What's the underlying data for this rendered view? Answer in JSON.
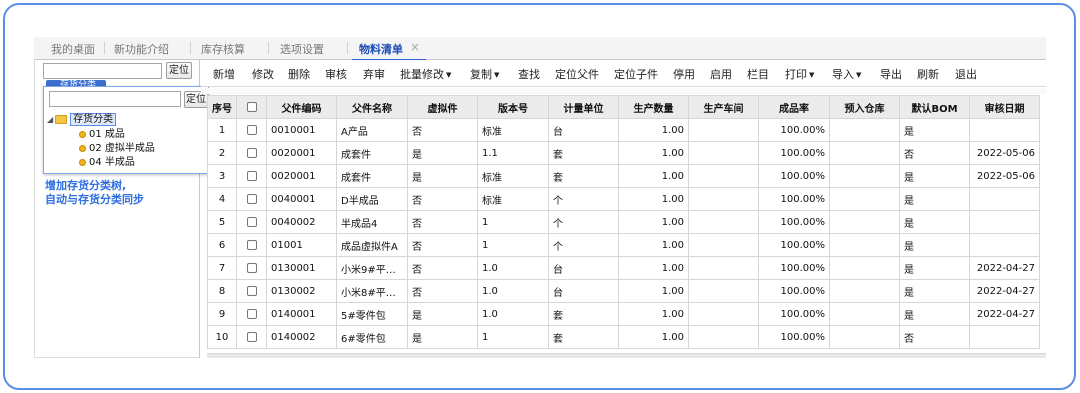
{
  "tabs": [
    {
      "label": "我的桌面"
    },
    {
      "label": "新功能介绍"
    },
    {
      "label": "库存核算"
    },
    {
      "label": "选项设置"
    },
    {
      "label": "物料清单",
      "active": true
    }
  ],
  "tab_close": "×",
  "left": {
    "locate_label": "定位",
    "search_value": "",
    "root_behind": "存货分类",
    "popup": {
      "locate_label": "定位",
      "search_value": "",
      "root": "存货分类",
      "children": [
        "01 成品",
        "02 虚拟半成品",
        "04 半成品"
      ]
    },
    "annotation_line1": "增加存货分类树,",
    "annotation_line2": "自动与存货分类同步"
  },
  "toolbar": [
    {
      "label": "新增"
    },
    {
      "label": "修改"
    },
    {
      "label": "删除"
    },
    {
      "label": "审核"
    },
    {
      "label": "弃审"
    },
    {
      "label": "批量修改",
      "dropdown": true
    },
    {
      "label": "复制",
      "dropdown": true
    },
    {
      "label": "查找"
    },
    {
      "label": "定位父件"
    },
    {
      "label": "定位子件"
    },
    {
      "label": "停用"
    },
    {
      "label": "启用"
    },
    {
      "label": "栏目"
    },
    {
      "label": "打印",
      "dropdown": true
    },
    {
      "label": "导入",
      "dropdown": true
    },
    {
      "label": "导出"
    },
    {
      "label": "刷新"
    },
    {
      "label": "退出"
    }
  ],
  "columns": [
    "序号",
    "",
    "父件编码",
    "父件名称",
    "虚拟件",
    "版本号",
    "计量单位",
    "生产数量",
    "生产车间",
    "成品率",
    "预入仓库",
    "默认BOM",
    "审核日期"
  ],
  "rows": [
    {
      "no": "1",
      "code": "0010001",
      "name": "A产品",
      "virtual": "否",
      "version": "标准",
      "unit": "台",
      "qty": "1.00",
      "workshop": "",
      "yield": "100.00%",
      "warehouse": "",
      "default_bom": "是",
      "audit_date": ""
    },
    {
      "no": "2",
      "code": "0020001",
      "name": "成套件",
      "virtual": "是",
      "version": "1.1",
      "unit": "套",
      "qty": "1.00",
      "workshop": "",
      "yield": "100.00%",
      "warehouse": "",
      "default_bom": "否",
      "audit_date": "2022-05-06"
    },
    {
      "no": "3",
      "code": "0020001",
      "name": "成套件",
      "virtual": "是",
      "version": "标准",
      "unit": "套",
      "qty": "1.00",
      "workshop": "",
      "yield": "100.00%",
      "warehouse": "",
      "default_bom": "是",
      "audit_date": "2022-05-06"
    },
    {
      "no": "4",
      "code": "0040001",
      "name": "D半成品",
      "virtual": "否",
      "version": "标准",
      "unit": "个",
      "qty": "1.00",
      "workshop": "",
      "yield": "100.00%",
      "warehouse": "",
      "default_bom": "是",
      "audit_date": ""
    },
    {
      "no": "5",
      "code": "0040002",
      "name": "半成品4",
      "virtual": "否",
      "version": "1",
      "unit": "个",
      "qty": "1.00",
      "workshop": "",
      "yield": "100.00%",
      "warehouse": "",
      "default_bom": "是",
      "audit_date": ""
    },
    {
      "no": "6",
      "code": "01001",
      "name": "成品虚拟件A",
      "virtual": "否",
      "version": "1",
      "unit": "个",
      "qty": "1.00",
      "workshop": "",
      "yield": "100.00%",
      "warehouse": "",
      "default_bom": "是",
      "audit_date": ""
    },
    {
      "no": "7",
      "code": "0130001",
      "name": "小米9#平…",
      "virtual": "否",
      "version": "1.0",
      "unit": "台",
      "qty": "1.00",
      "workshop": "",
      "yield": "100.00%",
      "warehouse": "",
      "default_bom": "是",
      "audit_date": "2022-04-27"
    },
    {
      "no": "8",
      "code": "0130002",
      "name": "小米8#平…",
      "virtual": "否",
      "version": "1.0",
      "unit": "台",
      "qty": "1.00",
      "workshop": "",
      "yield": "100.00%",
      "warehouse": "",
      "default_bom": "是",
      "audit_date": "2022-04-27"
    },
    {
      "no": "9",
      "code": "0140001",
      "name": "5#零件包",
      "virtual": "是",
      "version": "1.0",
      "unit": "套",
      "qty": "1.00",
      "workshop": "",
      "yield": "100.00%",
      "warehouse": "",
      "default_bom": "是",
      "audit_date": "2022-04-27"
    },
    {
      "no": "10",
      "code": "0140002",
      "name": "6#零件包",
      "virtual": "是",
      "version": "1",
      "unit": "套",
      "qty": "1.00",
      "workshop": "",
      "yield": "100.00%",
      "warehouse": "",
      "default_bom": "否",
      "audit_date": ""
    }
  ],
  "colors": {
    "accent": "#2a64d6",
    "frame": "#5b8fe6",
    "annotation": "#2f6fe0"
  }
}
